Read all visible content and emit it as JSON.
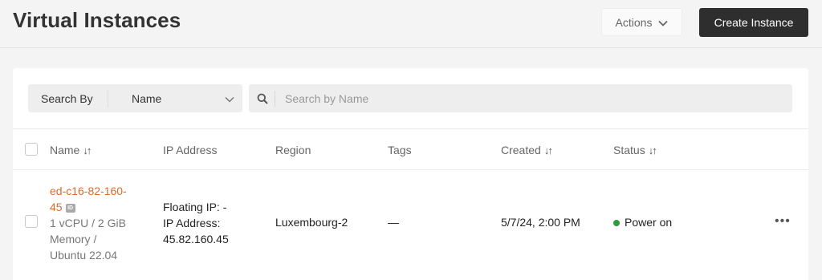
{
  "header": {
    "title": "Virtual Instances",
    "actions_label": "Actions",
    "create_label": "Create Instance"
  },
  "search": {
    "by_label": "Search By",
    "by_value": "Name",
    "placeholder": "Search by Name"
  },
  "table": {
    "columns": {
      "name": "Name",
      "ip": "IP Address",
      "region": "Region",
      "tags": "Tags",
      "created": "Created",
      "status": "Status"
    },
    "sort_glyph": "↓↑",
    "rows": [
      {
        "name_line1": "ed-c16-82-160-",
        "name_line2": "45",
        "id_badge": "ID",
        "spec_line1": "1 vCPU / 2 GiB",
        "spec_line2": "Memory /",
        "spec_line3": "Ubuntu 22.04",
        "floating_ip": "Floating IP: -",
        "ip_label": "IP Address:",
        "ip_value": "45.82.160.45",
        "region": "Luxembourg-2",
        "tags": "—",
        "created": "5/7/24, 2:00 PM",
        "status": "Power on",
        "status_color": "#2e9b3e",
        "more": "•••"
      }
    ]
  },
  "colors": {
    "accent": "#e0692b",
    "primary_button": "#2e2e2e",
    "background": "#f4f4f4"
  }
}
